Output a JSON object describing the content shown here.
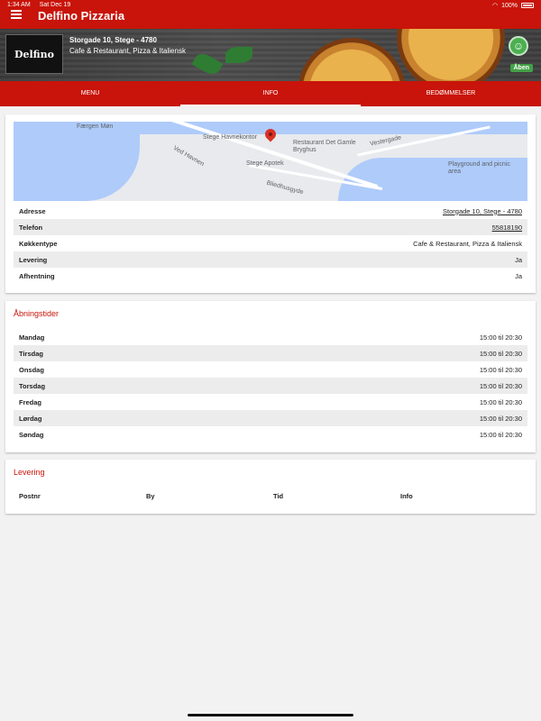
{
  "status": {
    "time": "1:34 AM",
    "date": "Sat Dec 19",
    "battery": "100%"
  },
  "header": {
    "title": "Delfino Pizzaria"
  },
  "shop": {
    "logo_text": "Delfino",
    "address_line": "Storgade 10, Stege - 4780",
    "type_line": "Cafe & Restaurant, Pizza & Italiensk",
    "open_badge": "Åben"
  },
  "tabs": [
    {
      "label": "MENU",
      "active": false
    },
    {
      "label": "INFO",
      "active": true
    },
    {
      "label": "BEDØMMELSER",
      "active": false
    }
  ],
  "map": {
    "labels": [
      "Færgen Møn",
      "Stege Havnekontor",
      "Restaurant Det Gamle Bryghus",
      "Stege Apotek",
      "Playground and picnic area",
      "Bliedhusgyde",
      "Ved Havnen",
      "Vestergade"
    ]
  },
  "info_rows": [
    {
      "label": "Adresse",
      "value": "Storgade 10, Stege - 4780",
      "link": true
    },
    {
      "label": "Telefon",
      "value": "55818190",
      "link": true
    },
    {
      "label": "Køkkentype",
      "value": "Cafe & Restaurant, Pizza & Italiensk",
      "link": false
    },
    {
      "label": "Levering",
      "value": "Ja",
      "link": false
    },
    {
      "label": "Afhentning",
      "value": "Ja",
      "link": false
    }
  ],
  "hours": {
    "title": "Åbningstider",
    "rows": [
      {
        "day": "Mandag",
        "time": "15:00 til 20:30"
      },
      {
        "day": "Tirsdag",
        "time": "15:00 til 20:30"
      },
      {
        "day": "Onsdag",
        "time": "15:00 til 20:30"
      },
      {
        "day": "Torsdag",
        "time": "15:00 til 20:30"
      },
      {
        "day": "Fredag",
        "time": "15:00 til 20:30"
      },
      {
        "day": "Lørdag",
        "time": "15:00 til 20:30"
      },
      {
        "day": "Søndag",
        "time": "15:00 til 20:30"
      }
    ]
  },
  "delivery": {
    "title": "Levering",
    "columns": [
      "Postnr",
      "By",
      "Tid",
      "Info"
    ]
  },
  "colors": {
    "primary": "#c8140a",
    "open": "#43a047"
  }
}
